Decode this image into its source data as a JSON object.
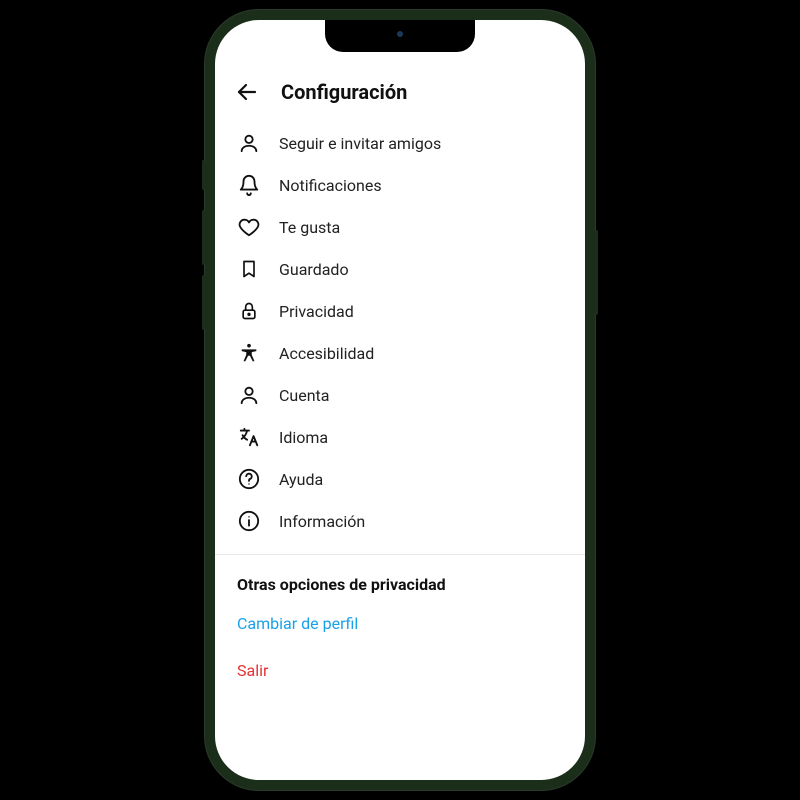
{
  "header": {
    "title": "Configuración"
  },
  "menu": [
    {
      "icon": "person",
      "label": "Seguir e invitar amigos"
    },
    {
      "icon": "bell",
      "label": "Notificaciones"
    },
    {
      "icon": "heart",
      "label": "Te gusta"
    },
    {
      "icon": "bookmark",
      "label": "Guardado"
    },
    {
      "icon": "lock",
      "label": "Privacidad"
    },
    {
      "icon": "accessibility",
      "label": "Accesibilidad"
    },
    {
      "icon": "person",
      "label": "Cuenta"
    },
    {
      "icon": "translate",
      "label": "Idioma"
    },
    {
      "icon": "help",
      "label": "Ayuda"
    },
    {
      "icon": "info",
      "label": "Información"
    }
  ],
  "section": {
    "title": "Otras opciones de privacidad"
  },
  "links": {
    "switch_profile": "Cambiar de perfil",
    "logout": "Salir"
  }
}
